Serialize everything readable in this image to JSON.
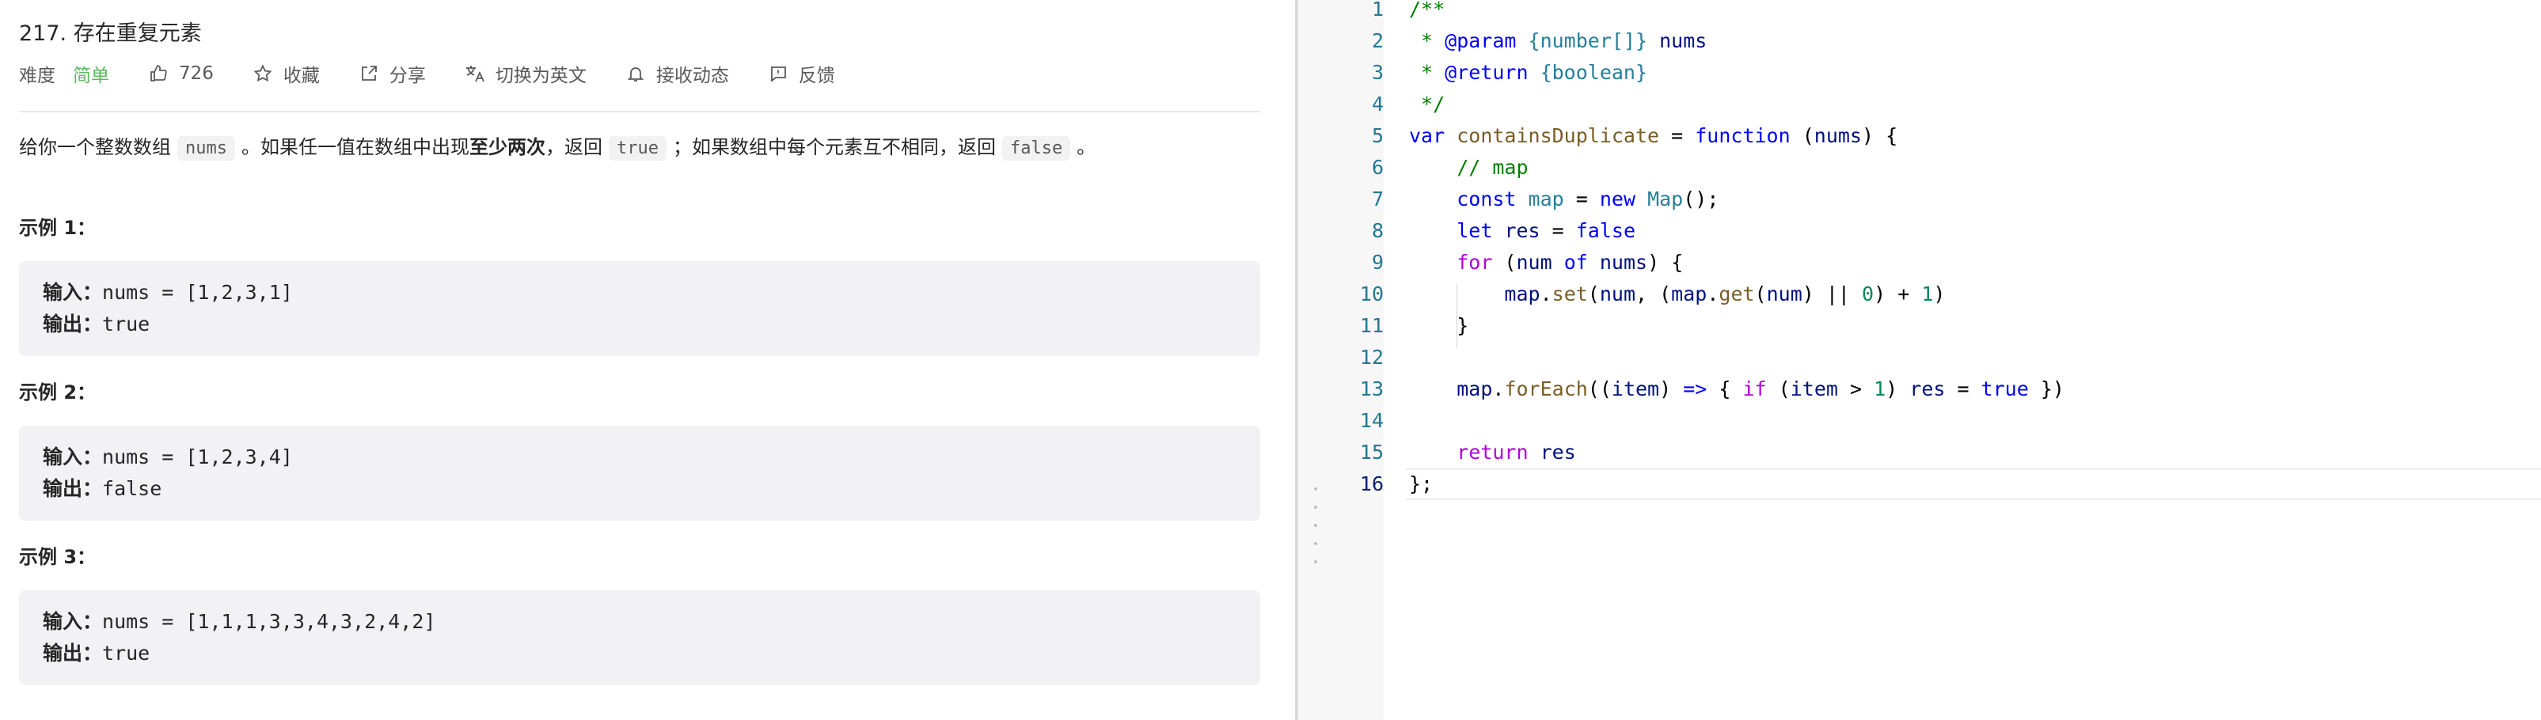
{
  "problem": {
    "title": "217. 存在重复元素",
    "meta": {
      "difficulty_label": "难度",
      "difficulty_value": "简单",
      "likes": "726",
      "favorite": "收藏",
      "share": "分享",
      "switch_lang": "切换为英文",
      "notify": "接收动态",
      "feedback": "反馈"
    },
    "description": {
      "p1": "给你一个整数数组",
      "c1": "nums",
      "p2": "。如果任一值在数组中出现",
      "bold": "至少两次",
      "p3": "，返回",
      "c2": "true",
      "p4": "；如果数组中每个元素互不相同，返回",
      "c3": "false",
      "p5": "。"
    },
    "examples": [
      {
        "title": "示例 1：",
        "input_label": "输入：",
        "input": "nums = [1,2,3,1]",
        "output_label": "输出：",
        "output": "true"
      },
      {
        "title": "示例 2：",
        "input_label": "输入：",
        "input": "nums = [1,2,3,4]",
        "output_label": "输出：",
        "output": "false"
      },
      {
        "title": "示例 3：",
        "input_label": "输入：",
        "input": "nums = [1,1,1,3,3,4,3,2,4,2]",
        "output_label": "输出：",
        "output": "true"
      }
    ]
  },
  "editor": {
    "current_line": 16,
    "line_numbers": [
      "1",
      "2",
      "3",
      "4",
      "5",
      "6",
      "7",
      "8",
      "9",
      "10",
      "11",
      "12",
      "13",
      "14",
      "15",
      "16"
    ],
    "lines": [
      [
        {
          "t": "/**",
          "c": "cmt"
        }
      ],
      [
        {
          "t": " * ",
          "c": "cmt"
        },
        {
          "t": "@param",
          "c": "tag"
        },
        {
          "t": " ",
          "c": "cmt"
        },
        {
          "t": "{number[]}",
          "c": "type"
        },
        {
          "t": " nums",
          "c": "var"
        }
      ],
      [
        {
          "t": " * ",
          "c": "cmt"
        },
        {
          "t": "@return",
          "c": "tag"
        },
        {
          "t": " ",
          "c": "cmt"
        },
        {
          "t": "{boolean}",
          "c": "type"
        }
      ],
      [
        {
          "t": " */",
          "c": "cmt"
        }
      ],
      [
        {
          "t": "var",
          "c": "kw"
        },
        {
          "t": " ",
          "c": ""
        },
        {
          "t": "containsDuplicate",
          "c": "fn"
        },
        {
          "t": " = ",
          "c": ""
        },
        {
          "t": "function",
          "c": "kw"
        },
        {
          "t": " (",
          "c": ""
        },
        {
          "t": "nums",
          "c": "var"
        },
        {
          "t": ") {",
          "c": ""
        }
      ],
      [
        {
          "t": "    ",
          "c": ""
        },
        {
          "t": "// map",
          "c": "cmt"
        }
      ],
      [
        {
          "t": "    ",
          "c": ""
        },
        {
          "t": "const",
          "c": "kw"
        },
        {
          "t": " ",
          "c": ""
        },
        {
          "t": "map",
          "c": "type"
        },
        {
          "t": " = ",
          "c": ""
        },
        {
          "t": "new",
          "c": "kw"
        },
        {
          "t": " ",
          "c": ""
        },
        {
          "t": "Map",
          "c": "type"
        },
        {
          "t": "();",
          "c": ""
        }
      ],
      [
        {
          "t": "    ",
          "c": ""
        },
        {
          "t": "let",
          "c": "kw"
        },
        {
          "t": " ",
          "c": ""
        },
        {
          "t": "res",
          "c": "var"
        },
        {
          "t": " = ",
          "c": ""
        },
        {
          "t": "false",
          "c": "bool"
        }
      ],
      [
        {
          "t": "    ",
          "c": ""
        },
        {
          "t": "for",
          "c": "ctl"
        },
        {
          "t": " (",
          "c": ""
        },
        {
          "t": "num",
          "c": "var"
        },
        {
          "t": " ",
          "c": ""
        },
        {
          "t": "of",
          "c": "kw"
        },
        {
          "t": " ",
          "c": ""
        },
        {
          "t": "nums",
          "c": "var"
        },
        {
          "t": ") {",
          "c": ""
        }
      ],
      [
        {
          "t": "        ",
          "c": ""
        },
        {
          "t": "map",
          "c": "var"
        },
        {
          "t": ".",
          "c": ""
        },
        {
          "t": "set",
          "c": "fn"
        },
        {
          "t": "(",
          "c": ""
        },
        {
          "t": "num",
          "c": "var"
        },
        {
          "t": ", (",
          "c": ""
        },
        {
          "t": "map",
          "c": "var"
        },
        {
          "t": ".",
          "c": ""
        },
        {
          "t": "get",
          "c": "fn"
        },
        {
          "t": "(",
          "c": ""
        },
        {
          "t": "num",
          "c": "var"
        },
        {
          "t": ") || ",
          "c": ""
        },
        {
          "t": "0",
          "c": "num"
        },
        {
          "t": ") + ",
          "c": ""
        },
        {
          "t": "1",
          "c": "num"
        },
        {
          "t": ")",
          "c": ""
        }
      ],
      [
        {
          "t": "    }",
          "c": ""
        }
      ],
      [],
      [
        {
          "t": "    ",
          "c": ""
        },
        {
          "t": "map",
          "c": "var"
        },
        {
          "t": ".",
          "c": ""
        },
        {
          "t": "forEach",
          "c": "fn"
        },
        {
          "t": "((",
          "c": ""
        },
        {
          "t": "item",
          "c": "var"
        },
        {
          "t": ") ",
          "c": ""
        },
        {
          "t": "=>",
          "c": "kw"
        },
        {
          "t": " { ",
          "c": ""
        },
        {
          "t": "if",
          "c": "ctl"
        },
        {
          "t": " (",
          "c": ""
        },
        {
          "t": "item",
          "c": "var"
        },
        {
          "t": " > ",
          "c": ""
        },
        {
          "t": "1",
          "c": "num"
        },
        {
          "t": ") ",
          "c": ""
        },
        {
          "t": "res",
          "c": "var"
        },
        {
          "t": " = ",
          "c": ""
        },
        {
          "t": "true",
          "c": "bool"
        },
        {
          "t": " })",
          "c": ""
        }
      ],
      [],
      [
        {
          "t": "    ",
          "c": ""
        },
        {
          "t": "return",
          "c": "ctl"
        },
        {
          "t": " ",
          "c": ""
        },
        {
          "t": "res",
          "c": "var"
        }
      ],
      [
        {
          "t": "};",
          "c": ""
        }
      ]
    ]
  },
  "colors": {
    "accent_easy": "#5cb85c",
    "line_number": "#237893"
  }
}
